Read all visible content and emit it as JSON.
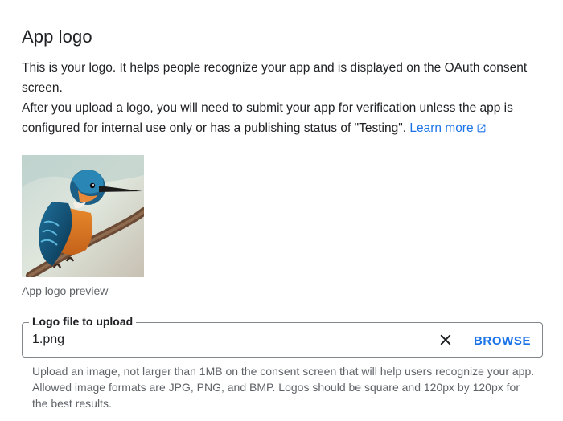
{
  "section": {
    "title": "App logo",
    "description_1": "This is your logo. It helps people recognize your app and is displayed on the OAuth consent screen.",
    "description_2": "After you upload a logo, you will need to submit your app for verification unless the app is configured for internal use only or has a publishing status of \"Testing\".",
    "learn_more": "Learn more"
  },
  "preview": {
    "caption": "App logo preview",
    "image_subject": "kingfisher painting"
  },
  "upload": {
    "label": "Logo file to upload",
    "value": "1.png",
    "clear_icon": "close-icon",
    "browse_label": "BROWSE",
    "helper": "Upload an image, not larger than 1MB on the consent screen that will help users recognize your app. Allowed image formats are JPG, PNG, and BMP. Logos should be square and 120px by 120px for the best results."
  },
  "colors": {
    "link": "#1a73e8",
    "text": "#202124",
    "muted": "#5f6368",
    "border": "#80868b"
  }
}
